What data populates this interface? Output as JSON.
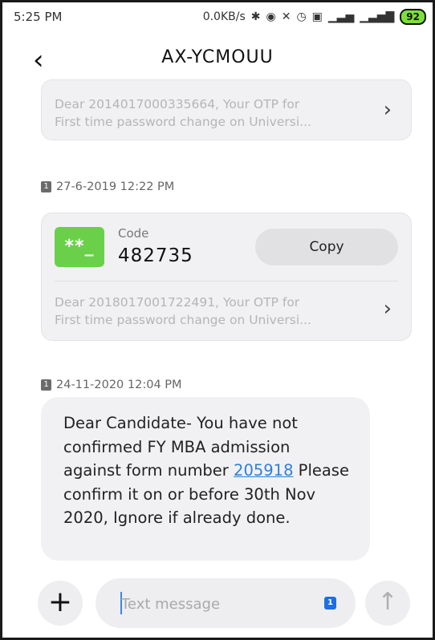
{
  "status_bar": {
    "time": "5:25 PM",
    "network_speed": "0.0KB/s",
    "icons": [
      "bluetooth-icon",
      "toggle-icon",
      "mute-icon",
      "alarm-icon",
      "volte-icon",
      "4g-signal-icon",
      "signal-icon"
    ],
    "battery": "92"
  },
  "header": {
    "title": "AX-YCMOUU",
    "back_icon": "back-arrow-icon"
  },
  "messages": {
    "first_snippet": {
      "line1": "Dear 2014017000335664, Your OTP for",
      "line2": "First time password change on Universi..."
    },
    "second": {
      "date": "27-6-2019 12:22 PM",
      "sim": "1",
      "code_icon_text": "**_",
      "code_label": "Code",
      "code_value": "482735",
      "copy_label": "Copy",
      "snippet_line1": "Dear 2018017001722491, Your OTP for",
      "snippet_line2": "First time password change on Universi..."
    },
    "third": {
      "date": "24-11-2020 12:04 PM",
      "sim": "1",
      "text_before_link": "Dear Candidate- You have not confirmed FY MBA admission against form number ",
      "link_text": "205918",
      "text_after_link": " Please confirm it on or before 30th Nov 2020, Ignore if already done."
    }
  },
  "composer": {
    "placeholder": "Text message",
    "sim_badge": "1",
    "plus_label": "+",
    "send_label": "↑"
  }
}
